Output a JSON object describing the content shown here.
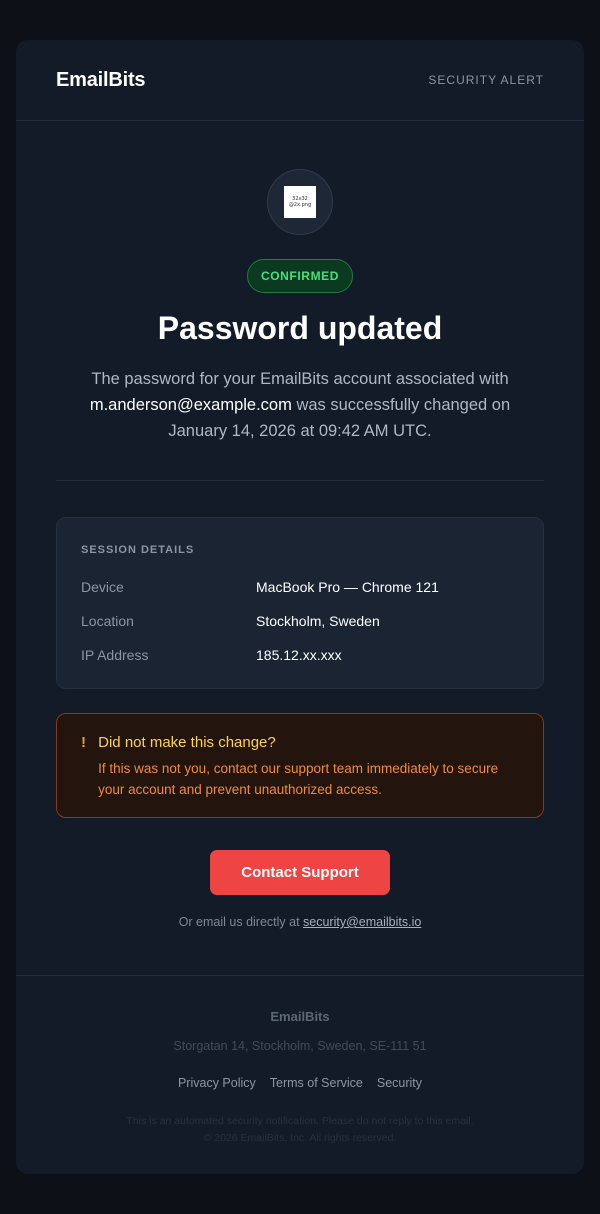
{
  "header": {
    "brand": "EmailBits",
    "alert_label": "SECURITY ALERT"
  },
  "hero": {
    "icon_placeholder": "32x32 @2x.png",
    "badge": "CONFIRMED",
    "title": "Password updated",
    "desc_before": "The password for your EmailBits account associated with ",
    "desc_email": "m.anderson@example.com",
    "desc_after": " was successfully changed on January 14, 2026 at 09:42 AM UTC."
  },
  "session": {
    "heading": "SESSION DETAILS",
    "rows": [
      {
        "label": "Device",
        "value": "MacBook Pro — Chrome 121"
      },
      {
        "label": "Location",
        "value": "Stockholm, Sweden"
      },
      {
        "label": "IP Address",
        "value": "185.12.xx.xxx"
      }
    ]
  },
  "warning": {
    "icon": "!",
    "title": "Did not make this change?",
    "text": "If this was not you, contact our support team immediately to secure your account and prevent unauthorized access."
  },
  "cta": {
    "label": "Contact Support"
  },
  "direct": {
    "prefix": "Or email us directly at ",
    "email": "security@emailbits.io"
  },
  "footer": {
    "brand": "EmailBits",
    "address": "Storgatan 14, Stockholm, Sweden, SE-111 51",
    "links": [
      "Privacy Policy",
      "Terms of Service",
      "Security"
    ],
    "note_line1": "This is an automated security notification. Please do not reply to this email.",
    "note_line2": "© 2026 EmailBits, Inc. All rights reserved."
  },
  "colors": {
    "page_bg": "#0d1117",
    "card_bg": "#141b28",
    "success": "#4ade80",
    "warning": "#fcd34d",
    "danger": "#ef4444"
  }
}
